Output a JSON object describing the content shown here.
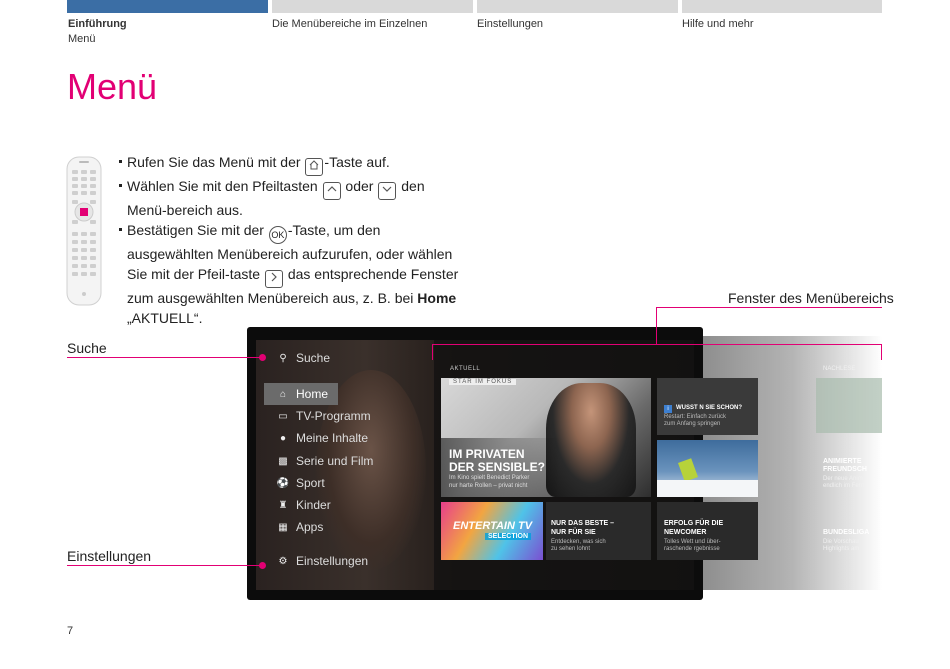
{
  "nav": {
    "tabs": [
      {
        "label": "Einführung",
        "sub": "Menü"
      },
      {
        "label": "Die Menübereiche im Einzelnen"
      },
      {
        "label": "Einstellungen"
      },
      {
        "label": "Hilfe und mehr"
      }
    ]
  },
  "page_title": "Menü",
  "bullets": {
    "b1_pre": "Rufen Sie das Menü mit der ",
    "b1_post": "-Taste auf.",
    "b2_pre": "Wählen Sie mit den Pfeiltasten ",
    "b2_mid": " oder ",
    "b2_post": " den Menü-bereich aus.",
    "b3_pre": "Bestätigen Sie mit der ",
    "b3_key": "OK",
    "b3_mid": "-Taste, um den ausgewählten Menübereich aufzurufen, oder wählen Sie mit der Pfeil-taste ",
    "b3_post": " das entsprechende Fenster zum ausgewählten Menübereich aus, z. B. bei ",
    "b3_bold": "Home",
    "b3_end": " „AKTUELL“."
  },
  "callouts": {
    "window": "Fenster des Menübereichs",
    "search": "Suche",
    "settings": "Einstellungen"
  },
  "tv": {
    "search": "Suche",
    "menu": [
      "Home",
      "TV-Programm",
      "Meine Inhalte",
      "Serie und Film",
      "Sport",
      "Kinder",
      "Apps"
    ],
    "settings": "Einstellungen",
    "section": "AKTUELL",
    "ghost_section": "NACHLESE",
    "star_label": "STAR IM FOKUS",
    "hero_title1": "IM PRIVATEN",
    "hero_title2": "DER SENSIBLE?",
    "hero_sub1": "Im Kino spielt Benedict Parker",
    "hero_sub2": "nur harte Rollen – privat nicht",
    "tile_wussten": "WUSST  N SIE SCHON?",
    "tile_wussten_sub1": "Restart: Einfach zurück",
    "tile_wussten_sub2": "zum Anfang  springen",
    "entertain1": "ENTERTAIN TV",
    "entertain2": "SELECTION",
    "best_title1": "NUR DAS BESTE –",
    "best_title2": "NUR FÜR SIE",
    "best_sub1": "Entdecken, was sich",
    "best_sub2": "zu sehen lohnt",
    "erfolg_title1": "ERFOLG  FÜR DIE",
    "erfolg_title2": "NEWCOMER",
    "erfolg_sub1": "Tolles Wett  und über-",
    "erfolg_sub2": "raschende  rgebnisse",
    "ghost_t1": "ANIMIERTE",
    "ghost_t2": "FREUNDSCH",
    "ghost_s1": "Der neue Anim",
    "ghost_s2": "endlich im Fern",
    "ghost_t3": "BUNDESLIGA",
    "ghost_s3": "Die Vorschau",
    "ghost_s4": "Highlights am"
  },
  "page_number": "7",
  "colors": {
    "accent": "#e20074"
  }
}
